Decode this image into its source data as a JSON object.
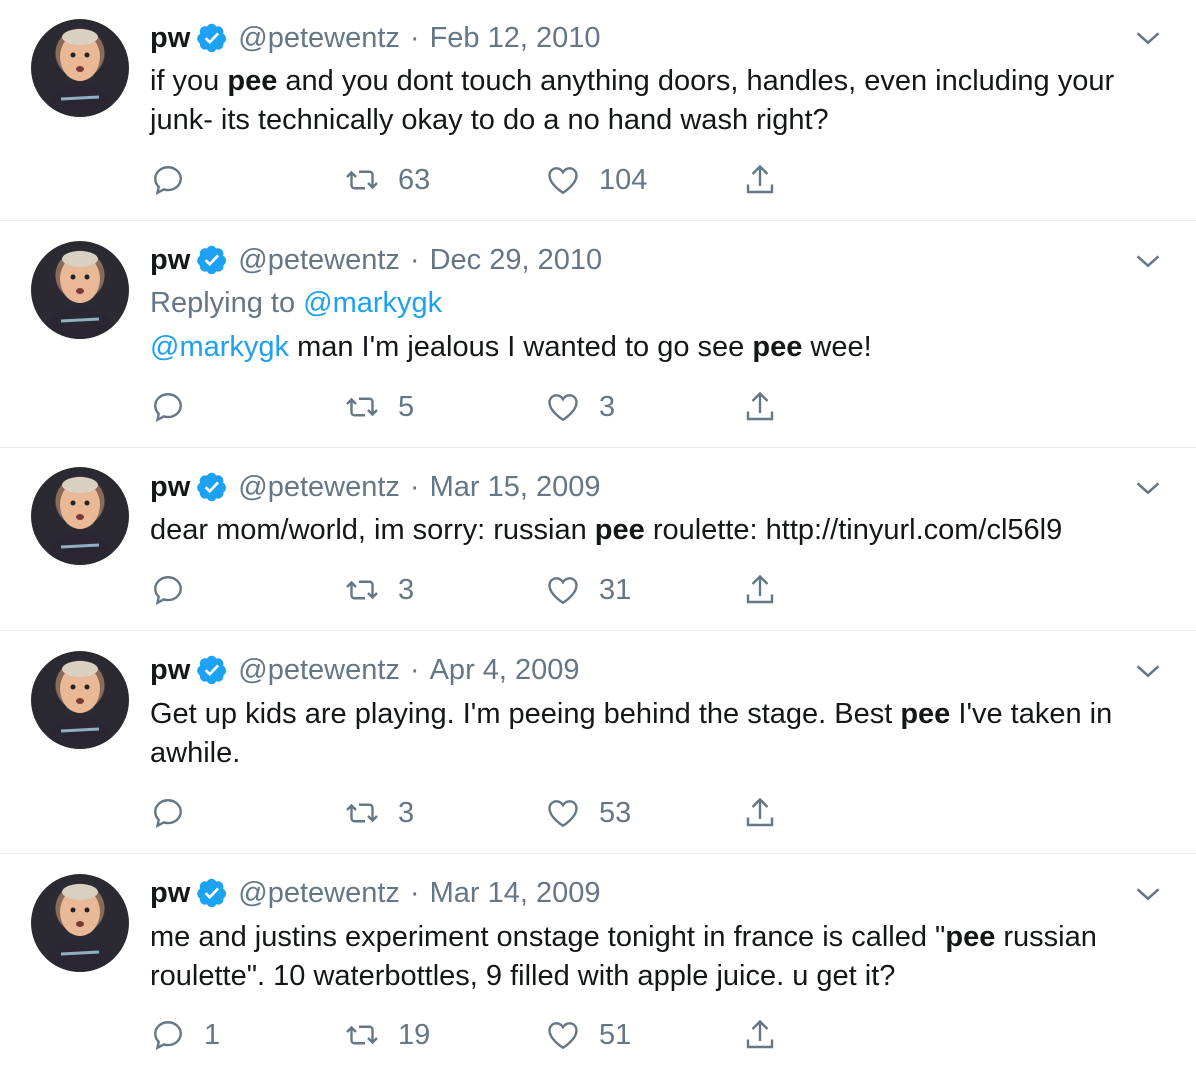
{
  "colors": {
    "accent": "#1da1f2",
    "muted": "#657786",
    "text": "#14171a",
    "border": "#e6ecf0"
  },
  "tweets": [
    {
      "name": "pw",
      "handle": "@petewentz",
      "sep": "·",
      "date": "Feb 12, 2010",
      "text": [
        {
          "t": "if you ",
          "b": false
        },
        {
          "t": "pee",
          "b": true
        },
        {
          "t": " and you dont touch anything doors, handles, even including your junk- its technically okay to do a no hand wash right?",
          "b": false
        }
      ],
      "replies": "",
      "retweets": "63",
      "likes": "104"
    },
    {
      "name": "pw",
      "handle": "@petewentz",
      "sep": "·",
      "date": "Dec 29, 2010",
      "replying_label": "Replying to",
      "replying_handle": "@markygk",
      "text": [
        {
          "t": "@markygk",
          "link": true
        },
        {
          "t": " man I'm jealous I wanted to go see ",
          "b": false
        },
        {
          "t": "pee",
          "b": true
        },
        {
          "t": " wee!",
          "b": false
        }
      ],
      "replies": "",
      "retweets": "5",
      "likes": "3"
    },
    {
      "name": "pw",
      "handle": "@petewentz",
      "sep": "·",
      "date": "Mar 15, 2009",
      "text": [
        {
          "t": "dear mom/world, im sorry: russian ",
          "b": false
        },
        {
          "t": "pee",
          "b": true
        },
        {
          "t": " roulette: http://tinyurl.com/cl56l9",
          "b": false
        }
      ],
      "replies": "",
      "retweets": "3",
      "likes": "31"
    },
    {
      "name": "pw",
      "handle": "@petewentz",
      "sep": "·",
      "date": "Apr 4, 2009",
      "text": [
        {
          "t": "Get up kids are playing. I'm peeing behind the stage. Best ",
          "b": false
        },
        {
          "t": "pee",
          "b": true
        },
        {
          "t": " I've taken in awhile.",
          "b": false
        }
      ],
      "replies": "",
      "retweets": "3",
      "likes": "53"
    },
    {
      "name": "pw",
      "handle": "@petewentz",
      "sep": "·",
      "date": "Mar 14, 2009",
      "text": [
        {
          "t": "me and justins experiment onstage tonight in france is called \"",
          "b": false
        },
        {
          "t": "pee",
          "b": true
        },
        {
          "t": " russian roulette\". 10 waterbottles, 9 filled with apple juice. u get it?",
          "b": false
        }
      ],
      "replies": "1",
      "retweets": "19",
      "likes": "51"
    }
  ]
}
